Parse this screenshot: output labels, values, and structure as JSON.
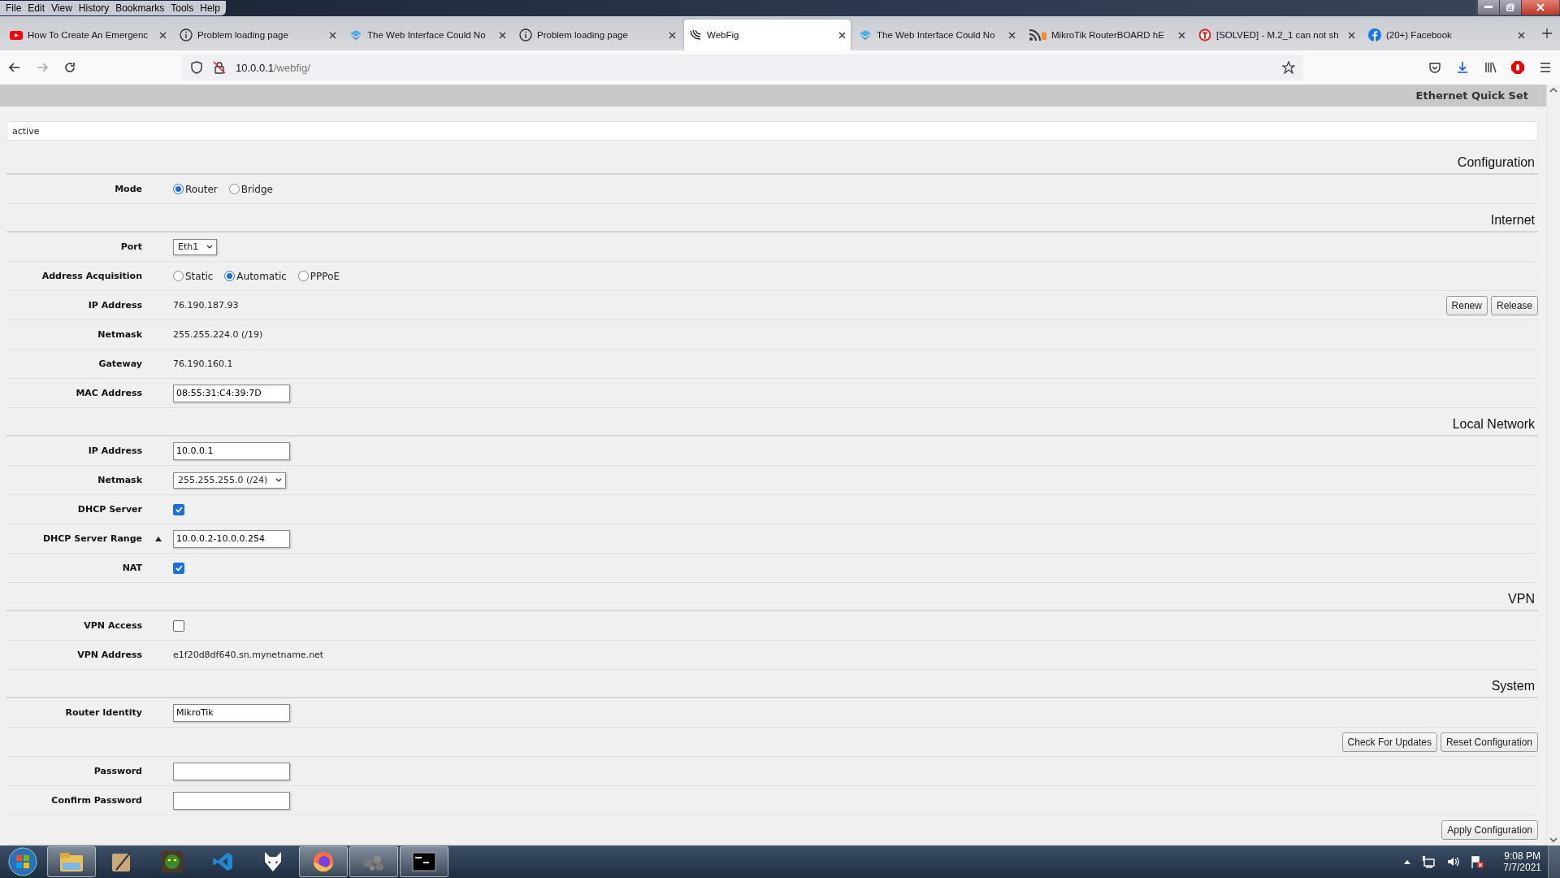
{
  "menu": [
    "File",
    "Edit",
    "View",
    "History",
    "Bookmarks",
    "Tools",
    "Help"
  ],
  "tabs": [
    {
      "title": "How To Create An Emergenc",
      "kind": "youtube",
      "selected": false
    },
    {
      "title": "Problem loading page",
      "kind": "info",
      "selected": false
    },
    {
      "title": "The Web Interface Could No",
      "kind": "diamond",
      "selected": false
    },
    {
      "title": "Problem loading page",
      "kind": "info",
      "selected": false
    },
    {
      "title": "WebFig",
      "kind": "webfig",
      "selected": true
    },
    {
      "title": "The Web Interface Could No",
      "kind": "diamond",
      "selected": false
    },
    {
      "title": "MikroTik RouterBOARD hE",
      "kind": "rss",
      "selected": false
    },
    {
      "title": "[SOLVED] - M.2_1 can not sh",
      "kind": "letter",
      "selected": false
    },
    {
      "title": "(20+) Facebook",
      "kind": "facebook",
      "selected": false
    }
  ],
  "address": {
    "host": "10.0.0.1",
    "path": "/webfig/"
  },
  "page": {
    "title": "Ethernet Quick Set",
    "status": "active",
    "sections": [
      {
        "title": "Configuration",
        "rows": [
          {
            "kind": "radio",
            "label": "Mode",
            "options": [
              {
                "label": "Router",
                "selected": true
              },
              {
                "label": "Bridge",
                "selected": false
              }
            ]
          }
        ]
      },
      {
        "title": "Internet",
        "rows": [
          {
            "kind": "select",
            "label": "Port",
            "value": "Eth1"
          },
          {
            "kind": "radio",
            "label": "Address Acquisition",
            "options": [
              {
                "label": "Static",
                "selected": false
              },
              {
                "label": "Automatic",
                "selected": true
              },
              {
                "label": "PPPoE",
                "selected": false
              }
            ]
          },
          {
            "kind": "text",
            "label": "IP Address",
            "value": "76.190.187.93",
            "buttons": [
              "Renew",
              "Release"
            ]
          },
          {
            "kind": "text",
            "label": "Netmask",
            "value": "255.255.224.0 (/19)"
          },
          {
            "kind": "text",
            "label": "Gateway",
            "value": "76.190.160.1"
          },
          {
            "kind": "input",
            "label": "MAC Address",
            "value": "08:55:31:C4:39:7D"
          }
        ]
      },
      {
        "title": "Local Network",
        "rows": [
          {
            "kind": "input",
            "label": "IP Address",
            "value": "10.0.0.1"
          },
          {
            "kind": "select",
            "label": "Netmask",
            "value": "255.255.255.0 (/24)"
          },
          {
            "kind": "checkbox",
            "label": "DHCP Server",
            "checked": true
          },
          {
            "kind": "input",
            "label": "DHCP Server Range",
            "value": "10.0.0.2-10.0.0.254",
            "expanded": true
          },
          {
            "kind": "checkbox",
            "label": "NAT",
            "checked": true
          }
        ]
      },
      {
        "title": "VPN",
        "rows": [
          {
            "kind": "checkbox",
            "label": "VPN Access",
            "checked": false
          },
          {
            "kind": "text",
            "label": "VPN Address",
            "value": "e1f20d8df640.sn.mynetname.net"
          }
        ]
      },
      {
        "title": "System",
        "rows": [
          {
            "kind": "input",
            "label": "Router Identity",
            "value": "MikroTik"
          },
          {
            "kind": "actions",
            "buttons": [
              "Check For Updates",
              "Reset Configuration"
            ]
          },
          {
            "kind": "input",
            "label": "Password"
          },
          {
            "kind": "input",
            "label": "Confirm Password"
          },
          {
            "kind": "actions",
            "buttons": [
              "Apply Configuration"
            ]
          }
        ]
      }
    ]
  },
  "taskbar": {
    "apps": [
      {
        "kind": "folder",
        "open": true
      },
      {
        "kind": "scroll",
        "open": false
      },
      {
        "kind": "monster",
        "open": false
      },
      {
        "kind": "code",
        "open": false
      },
      {
        "kind": "mask",
        "open": false
      },
      {
        "kind": "firefox",
        "open": true
      },
      {
        "kind": "blobs",
        "open": true
      },
      {
        "kind": "terminal",
        "open": true
      }
    ],
    "time": "9:08 PM",
    "date": "7/7/2021"
  }
}
